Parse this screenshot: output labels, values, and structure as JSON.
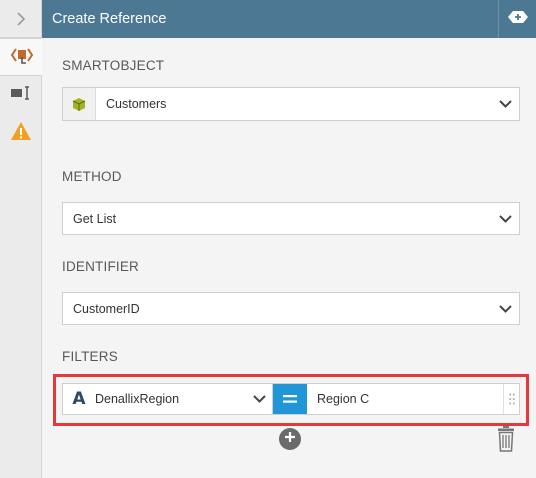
{
  "header": {
    "title": "Create Reference"
  },
  "rail": {
    "expand_icon": "chevron-right-icon",
    "items": [
      {
        "icon": "smartobject-reference-icon",
        "active": true
      },
      {
        "icon": "text-cursor-panel-icon",
        "active": false
      },
      {
        "icon": "warning-icon",
        "active": false
      }
    ]
  },
  "smartobject": {
    "label": "SMARTOBJECT",
    "value": "Customers"
  },
  "method": {
    "label": "METHOD",
    "value": "Get List"
  },
  "identifier": {
    "label": "IDENTIFIER",
    "value": "CustomerID"
  },
  "filters": {
    "label": "FILTERS",
    "rows": [
      {
        "type_glyph": "A",
        "field": "DenallixRegion",
        "operator": "=",
        "value": "Region C"
      }
    ]
  },
  "colors": {
    "header": "#4d7893",
    "operator": "#2196d6",
    "highlight": "#e5383b",
    "warning": "#f2a024"
  }
}
